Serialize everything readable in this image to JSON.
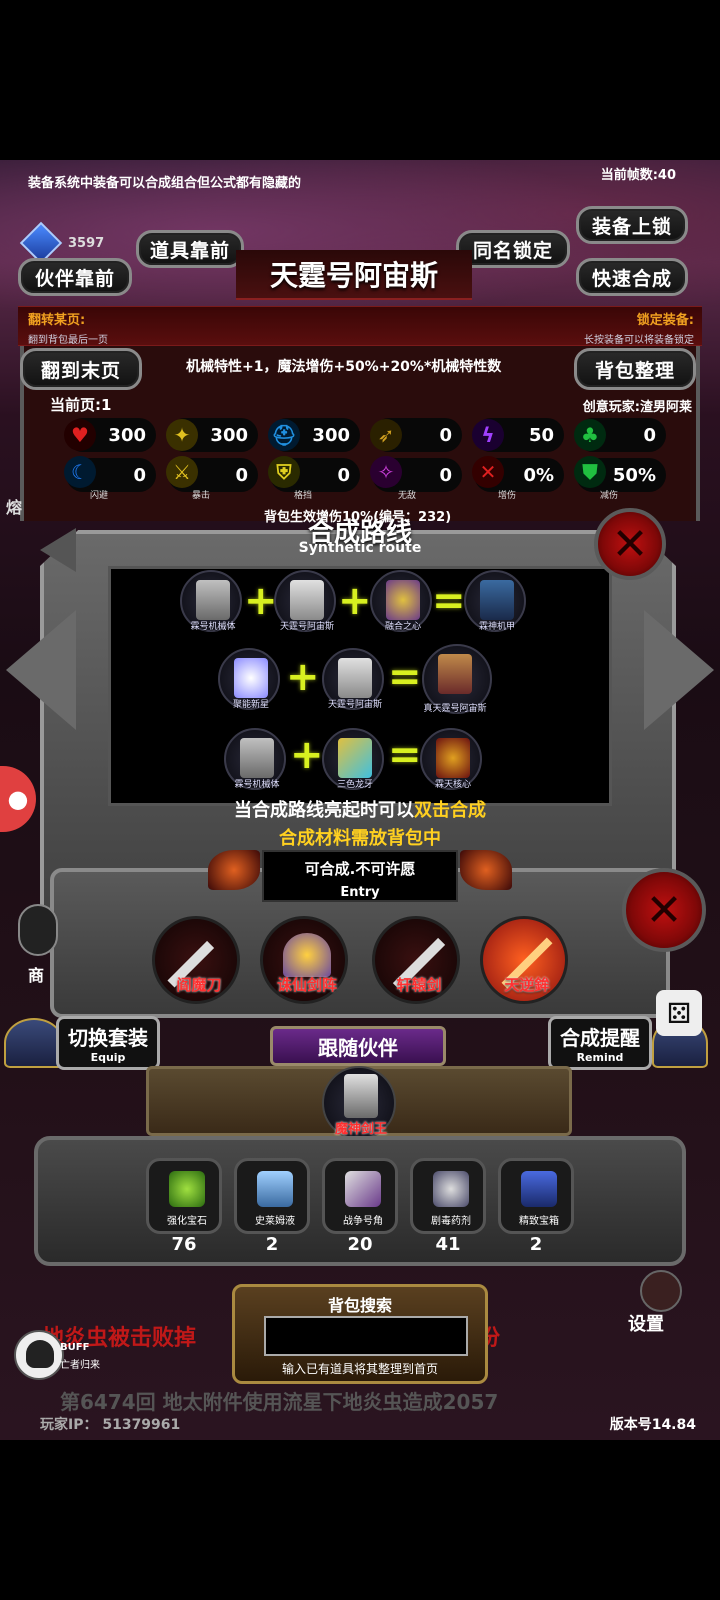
{
  "tip": "装备系统中装备可以合成组合但公式都有隐藏的",
  "fps": "当前帧数:40",
  "currency_value": "3597",
  "buttons": {
    "partner_front": "伙伴靠前",
    "item_front": "道具靠前",
    "same_name_lock": "同名锁定",
    "equip_lock": "装备上锁",
    "quick_synth": "快速合成",
    "to_last_page": "翻到末页",
    "bag_sort": "背包整理"
  },
  "title": "天霆号阿宙斯",
  "flip_page": {
    "label": "翻转某页:",
    "sub": "翻到背包最后一页"
  },
  "lock_equip": {
    "label": "锁定装备:",
    "sub": "长按装备可以将装备锁定"
  },
  "description": "机械特性+1，魔法增伤+50%+20%*机械特性数",
  "current_page": "当前页:1",
  "creator": "创意玩家:渣男阿莱",
  "stats_row1": [
    {
      "icon": "heart-icon",
      "value": "300"
    },
    {
      "icon": "strength-icon",
      "value": "300"
    },
    {
      "icon": "helmet-icon",
      "value": "300"
    },
    {
      "icon": "bow-icon",
      "value": "0"
    },
    {
      "icon": "lightning-icon",
      "value": "50"
    },
    {
      "icon": "clover-icon",
      "value": "0"
    }
  ],
  "stats_row2": [
    {
      "icon": "dodge-icon",
      "value": "0",
      "caption": "闪避"
    },
    {
      "icon": "crit-icon",
      "value": "0",
      "caption": "暴击"
    },
    {
      "icon": "block-icon",
      "value": "0",
      "caption": "格挡"
    },
    {
      "icon": "invincible-icon",
      "value": "0",
      "caption": "无敌"
    },
    {
      "icon": "damage-up-icon",
      "value": "0%",
      "caption": "增伤"
    },
    {
      "icon": "damage-reduce-icon",
      "value": "50%",
      "caption": "减伤"
    }
  ],
  "bag_effect": "背包生效增伤10%(编号：232)",
  "synth": {
    "title": "合成路线",
    "subtitle": "Synthetic route",
    "routes": [
      [
        "霖号机械体",
        "天霆号阿宙斯",
        "融合之心",
        "霖神机甲"
      ],
      [
        "聚能新星",
        "天霆号阿宙斯",
        "真天霆号阿宙斯"
      ],
      [
        "霖号机械体",
        "三色龙牙",
        "霖天核心"
      ]
    ],
    "hint_prefix": "当合成路线亮起时可以",
    "hint_highlight": "双击合成",
    "hint2": "合成材料需放背包中"
  },
  "entry": {
    "text": "可合成.不可许愿",
    "label": "Entry"
  },
  "weapons": [
    "阎魔刀",
    "诛仙剑阵",
    "轩辕剑",
    "天逆鉾"
  ],
  "switch_equip": {
    "label": "切换套装",
    "sub": "Equip"
  },
  "synth_remind": {
    "label": "合成提醒",
    "sub": "Remind"
  },
  "follow": {
    "label": "跟随伙伴",
    "companion": "魔神剑王"
  },
  "materials": [
    {
      "name": "强化宝石",
      "count": "76"
    },
    {
      "name": "史莱姆液",
      "count": "2"
    },
    {
      "name": "战争号角",
      "count": "20"
    },
    {
      "name": "剧毒药剂",
      "count": "41"
    },
    {
      "name": "精致宝箱",
      "count": "2"
    }
  ],
  "search": {
    "title": "背包搜索",
    "value": "",
    "hint": "输入已有道具将其整理到首页"
  },
  "bg_text": {
    "line1": "地炎虫被击败掉",
    "line1_tail": "份",
    "line2": "第6474回 地太附件使用流星下地炎虫造成2057"
  },
  "left_edge_char": "熔",
  "shop_label": "商",
  "setting_label": "设置",
  "buff": {
    "label": "BUFF",
    "sub": "亡者归来"
  },
  "player_ip": "玩家IP： 51379961",
  "version": "版本号14.84"
}
